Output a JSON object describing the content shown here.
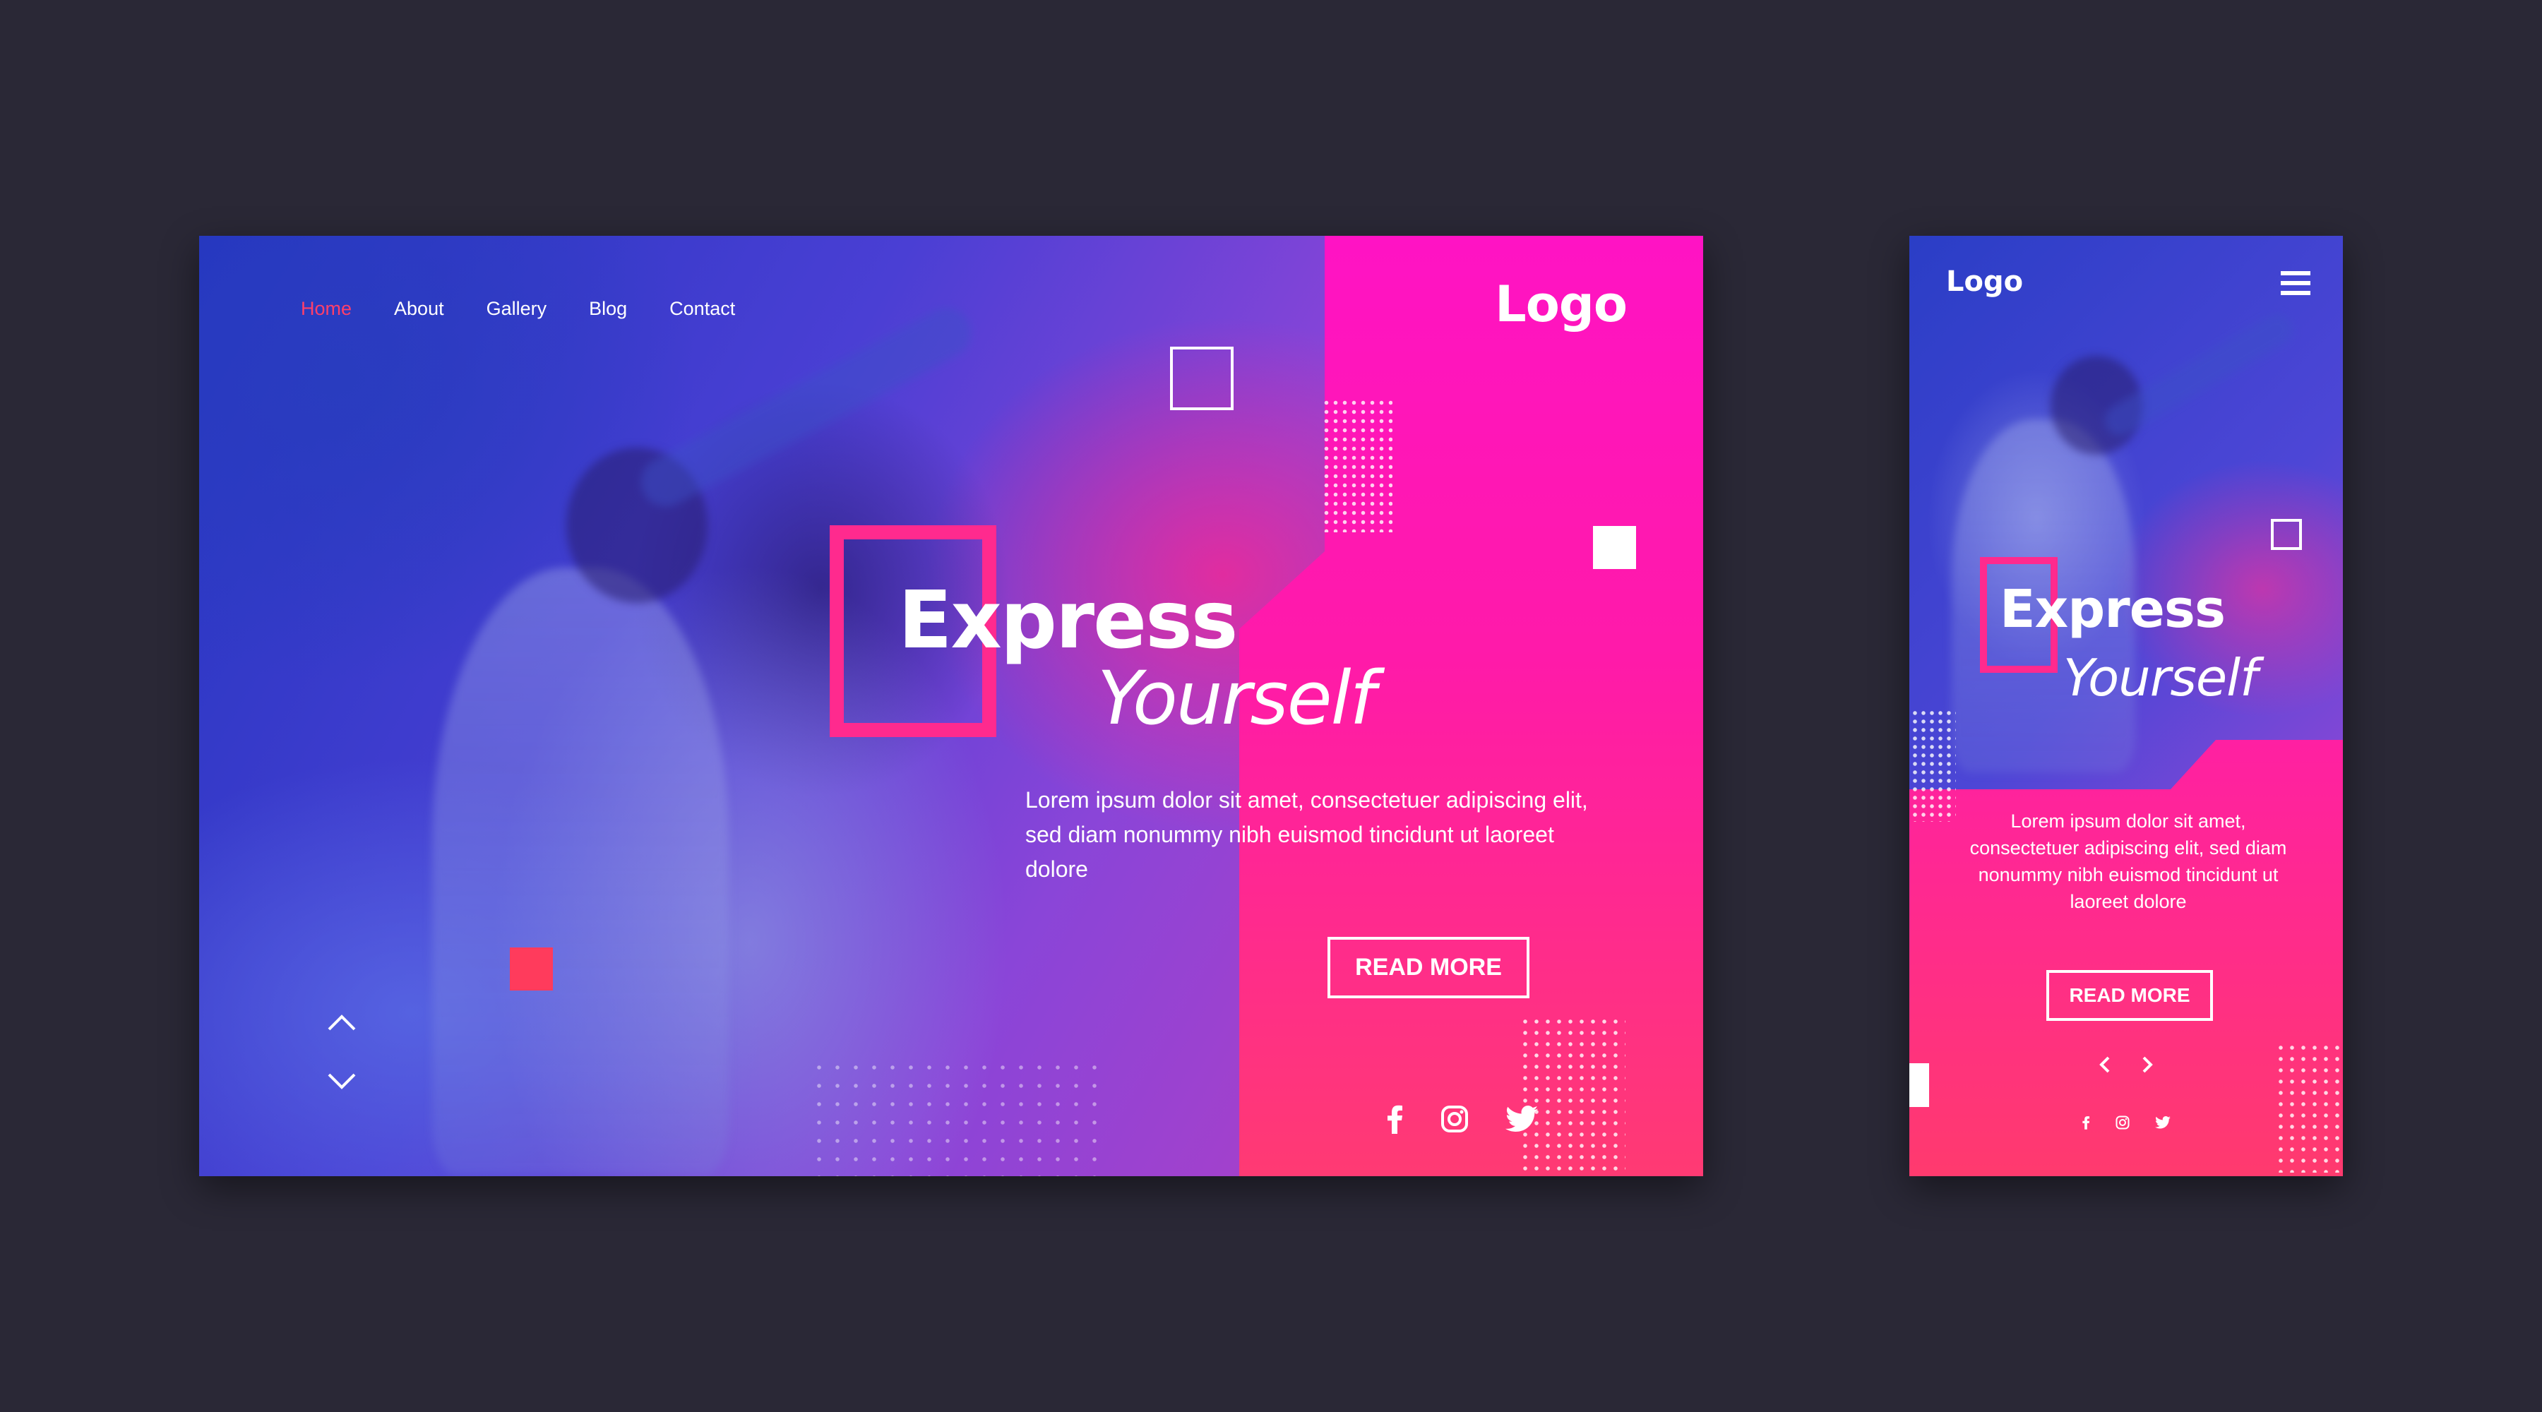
{
  "desktop": {
    "nav": [
      "Home",
      "About",
      "Gallery",
      "Blog",
      "Contact"
    ],
    "logo": "Logo",
    "headline": {
      "line1": "Express",
      "line2": "Yourself"
    },
    "body": "Lorem ipsum dolor sit amet, consectetuer adipiscing elit, sed diam nonummy nibh euismod tincidunt ut laoreet dolore",
    "button": "READ MORE",
    "social_icons": [
      "facebook-icon",
      "instagram-icon",
      "twitter-icon"
    ]
  },
  "mobile": {
    "logo": "Logo",
    "headline": {
      "line1": "Express",
      "line2": "Yourself"
    },
    "body": "Lorem ipsum dolor sit amet, consectetuer adipiscing elit, sed diam nonummy nibh euismod tincidunt ut laoreet dolore",
    "button": "READ MORE",
    "social_icons": [
      "facebook-icon",
      "instagram-icon",
      "twitter-icon"
    ]
  },
  "colors": {
    "background": "#2a2836",
    "accent_pink": "#ff1aa9",
    "accent_red": "#ff3b5c",
    "nav_active": "#ff3f6a",
    "photo_blue": "#2436c0"
  }
}
